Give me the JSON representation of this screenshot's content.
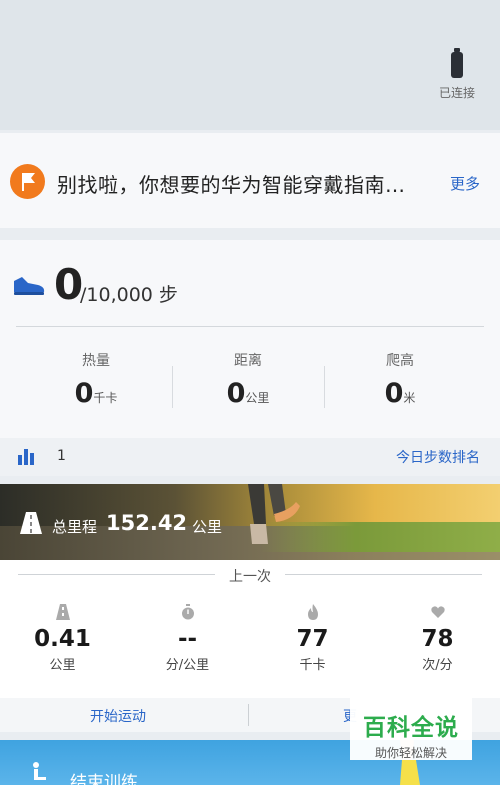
{
  "device": {
    "status": "已连接",
    "icon": "watch-icon"
  },
  "tip": {
    "text": "别找啦，你想要的华为智能穿戴指南…",
    "more": "更多",
    "icon": "flag-icon",
    "icon_color": "#f17a1d"
  },
  "steps": {
    "value": "0",
    "unit": "/10,000 步",
    "icon": "shoe-icon"
  },
  "stats": [
    {
      "label": "热量",
      "value": "0",
      "unit": "千卡"
    },
    {
      "label": "距离",
      "value": "0",
      "unit": "公里"
    },
    {
      "label": "爬高",
      "value": "0",
      "unit": "米"
    }
  ],
  "rank": {
    "value": "1",
    "link": "今日步数排名",
    "icon": "bar-chart-icon"
  },
  "total": {
    "label": "总里程",
    "value": "152.42",
    "unit": "公里",
    "icon": "road-icon"
  },
  "last": {
    "title": "上一次",
    "metrics": [
      {
        "value": "0.41",
        "unit": "公里",
        "icon": "distance-icon"
      },
      {
        "value": "--",
        "unit": "分/公里",
        "icon": "stopwatch-icon"
      },
      {
        "value": "77",
        "unit": "千卡",
        "icon": "flame-icon"
      },
      {
        "value": "78",
        "unit": "次/分",
        "icon": "heart-icon"
      }
    ]
  },
  "actions": {
    "start": "开始运动",
    "more": "更"
  },
  "training": {
    "label": "结束训练",
    "icon": "walker-icon"
  },
  "watermark": {
    "title": "百科全说",
    "subtitle": "助你轻松解决"
  },
  "colors": {
    "accent": "#2a66c8",
    "watermark": "#2dac4d",
    "training_bg": "#3fa3e0"
  }
}
